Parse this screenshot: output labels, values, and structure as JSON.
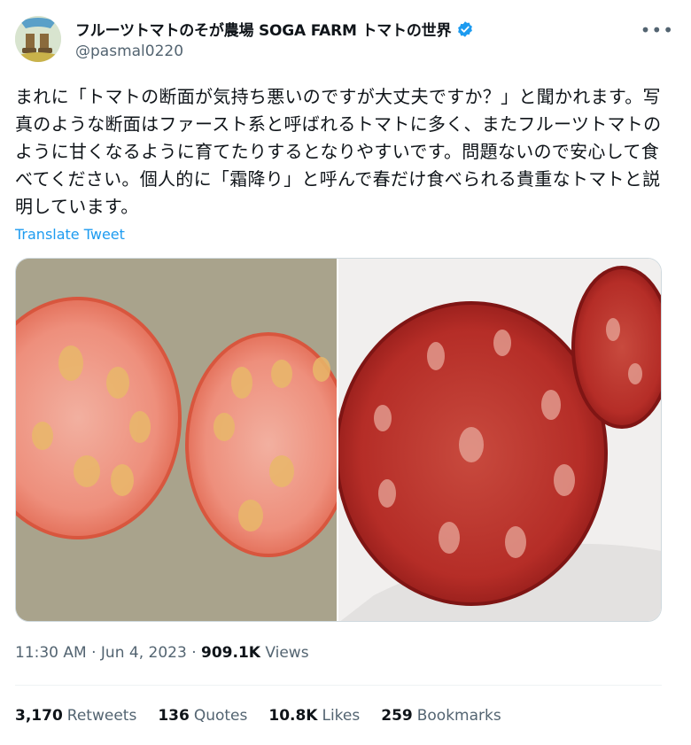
{
  "author": {
    "display_name": "フルーツトマトのそが農場 SOGA FARM トマトの世界",
    "handle": "@pasmal0220",
    "verified": true,
    "avatar_icon": "farmer-boots-avatar"
  },
  "more_icon": "more-horizontal-icon",
  "tweet": {
    "text": "まれに「トマトの断面が気持ち悪いのですが大丈夫ですか？」と聞かれます。写真のような断面はファースト系と呼ばれるトマトに多く、またフルーツトマトのように甘くなるように育てたりするとなりやすいです。問題ないので安心して食べてください。個人的に「霜降り」と呼んで春だけ食べられる貴重なトマトと説明しています。",
    "translate_label": "Translate Tweet"
  },
  "media": {
    "left_photo": "halved-pink-tomato-photo",
    "right_photo": "sliced-red-tomato-photo"
  },
  "meta": {
    "time": "11:30 AM",
    "date": "Jun 4, 2023",
    "views_count": "909.1K",
    "views_label": "Views"
  },
  "stats": [
    {
      "count": "3,170",
      "label": "Retweets"
    },
    {
      "count": "136",
      "label": "Quotes"
    },
    {
      "count": "10.8K",
      "label": "Likes"
    },
    {
      "count": "259",
      "label": "Bookmarks"
    }
  ],
  "colors": {
    "accent": "#1d9bf0",
    "secondary_text": "#536471",
    "primary_text": "#0f1419"
  }
}
